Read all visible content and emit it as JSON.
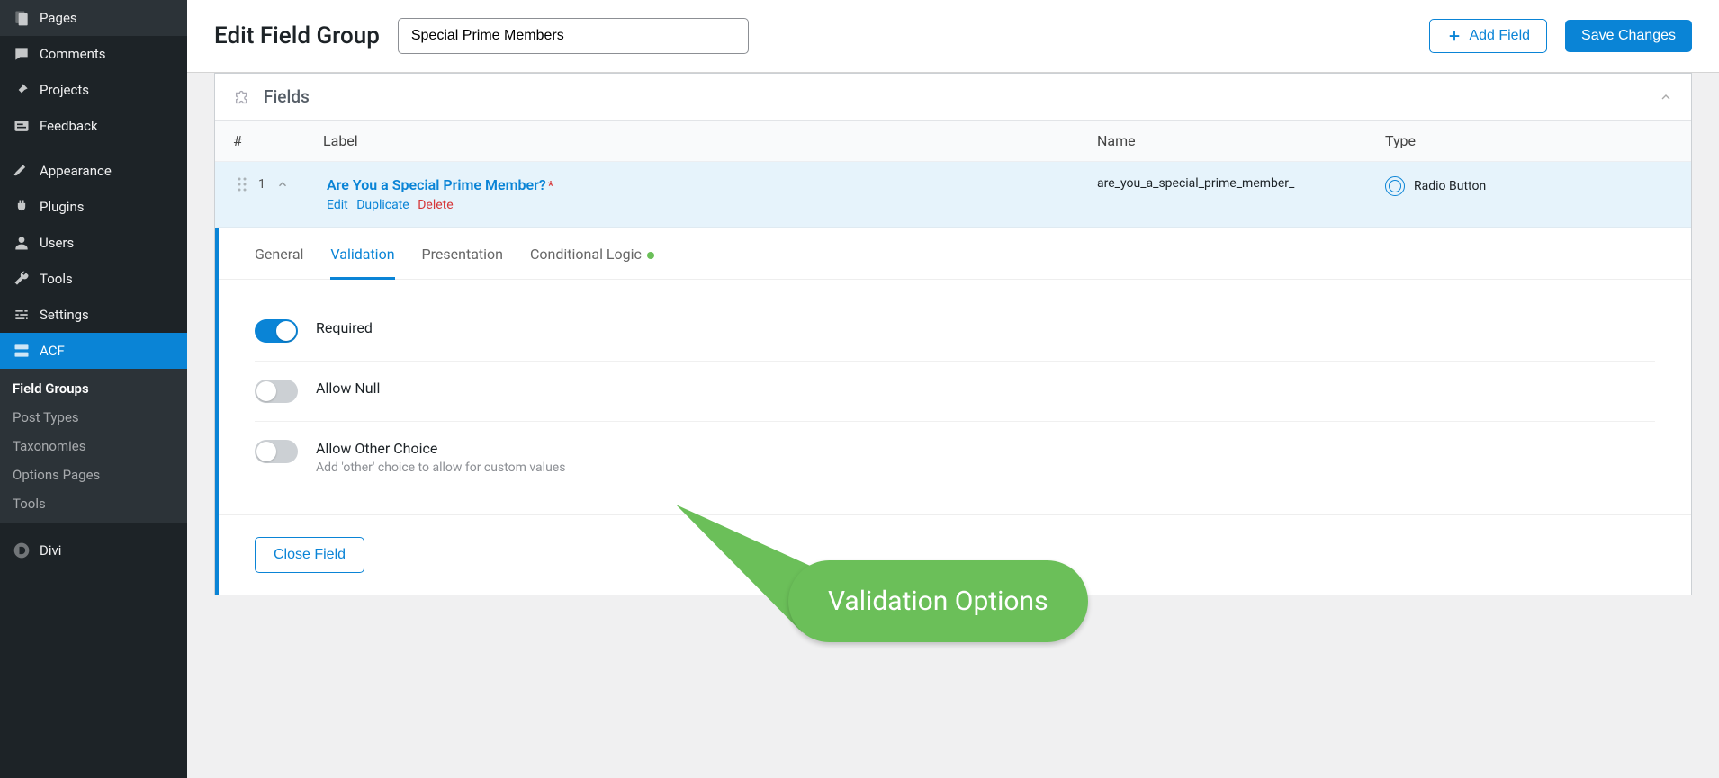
{
  "sidebar": {
    "items": [
      {
        "label": "Pages"
      },
      {
        "label": "Comments"
      },
      {
        "label": "Projects"
      },
      {
        "label": "Feedback"
      },
      {
        "label": "Appearance"
      },
      {
        "label": "Plugins"
      },
      {
        "label": "Users"
      },
      {
        "label": "Tools"
      },
      {
        "label": "Settings"
      },
      {
        "label": "ACF"
      },
      {
        "label": "Divi"
      }
    ],
    "submenu": [
      {
        "label": "Field Groups"
      },
      {
        "label": "Post Types"
      },
      {
        "label": "Taxonomies"
      },
      {
        "label": "Options Pages"
      },
      {
        "label": "Tools"
      }
    ]
  },
  "header": {
    "title": "Edit Field Group",
    "group_name": "Special Prime Members",
    "add_field": "Add Field",
    "save": "Save Changes"
  },
  "panel": {
    "title": "Fields",
    "columns": {
      "hash": "#",
      "label": "Label",
      "name": "Name",
      "type": "Type"
    }
  },
  "field": {
    "order": "1",
    "label": "Are You a Special Prime Member?",
    "name": "are_you_a_special_prime_member_",
    "type": "Radio Button",
    "actions": {
      "edit": "Edit",
      "duplicate": "Duplicate",
      "delete": "Delete"
    }
  },
  "tabs": [
    {
      "label": "General"
    },
    {
      "label": "Validation"
    },
    {
      "label": "Presentation"
    },
    {
      "label": "Conditional Logic"
    }
  ],
  "settings": {
    "required": "Required",
    "allow_null": "Allow Null",
    "allow_other": "Allow Other Choice",
    "allow_other_desc": "Add 'other' choice to allow for custom values"
  },
  "close_field": "Close Field",
  "callout": "Validation Options"
}
